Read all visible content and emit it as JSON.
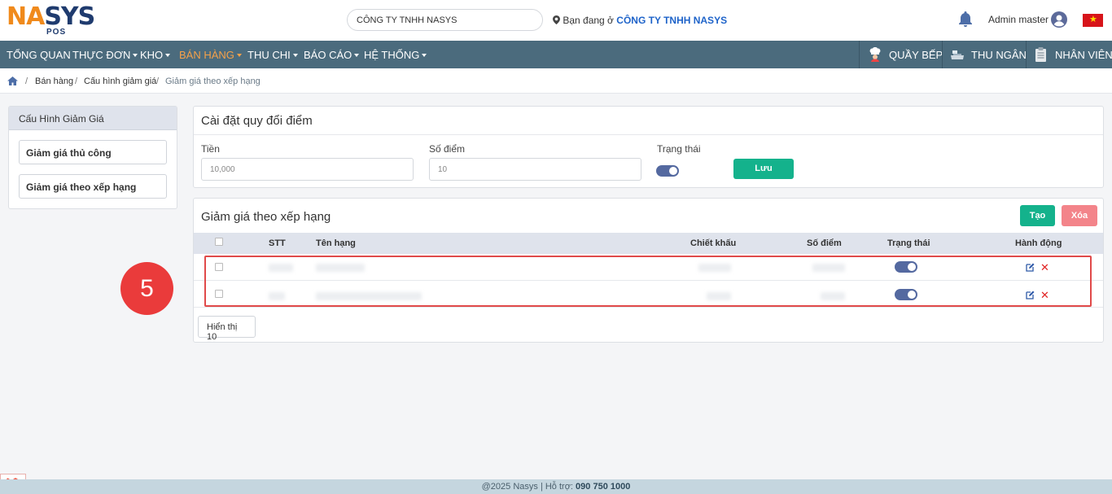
{
  "header": {
    "logo": {
      "part1": "NA",
      "part2": "SYS",
      "sub": "POS"
    },
    "company_select": "CÔNG TY TNHH NASYS",
    "location_prefix": "Bạn đang ở",
    "location_company": "CÔNG TY TNHH NASYS",
    "user_name": "Admin master",
    "colors": {
      "brand_orange": "#f08a1c",
      "brand_navy": "#1f3b6e",
      "link_blue": "#1e63c9"
    }
  },
  "nav": {
    "items": [
      {
        "label": "TỔNG QUAN"
      },
      {
        "label": "THỰC ĐƠN"
      },
      {
        "label": "KHO"
      },
      {
        "label": "BÁN HÀNG"
      },
      {
        "label": "THU CHI"
      },
      {
        "label": "BÁO CÁO"
      },
      {
        "label": "HỆ THỐNG"
      }
    ],
    "right": [
      {
        "label": "QUẦY BẾP",
        "icon": "chef-icon"
      },
      {
        "label": "THU NGÂN",
        "icon": "cashier-icon"
      },
      {
        "label": "NHÂN VIÊN",
        "icon": "clipboard-icon"
      }
    ],
    "colors": {
      "bg": "#4b6b7d",
      "active": "#f5a14a"
    }
  },
  "breadcrumb": [
    "Bán hàng",
    "Cấu hình giảm giá",
    "Giảm giá theo xếp hạng"
  ],
  "sidebar": {
    "title": "Cấu Hình Giảm Giá",
    "items": [
      {
        "label": "Giảm giá thủ công"
      },
      {
        "label": "Giảm giá theo xếp hạng"
      }
    ]
  },
  "points_panel": {
    "title": "Cài đặt quy đổi điểm",
    "money_label": "Tiền",
    "money_value": "10,000",
    "points_label": "Số điểm",
    "points_value": "10",
    "status_label": "Trạng thái",
    "save_label": "Lưu"
  },
  "rank_panel": {
    "title": "Giảm giá theo xếp hạng",
    "create_label": "Tạo",
    "delete_label": "Xóa",
    "columns": {
      "stt": "STT",
      "name": "Tên hạng",
      "discount": "Chiết khấu",
      "points": "Số điểm",
      "status": "Trạng thái",
      "actions": "Hành động"
    },
    "show_label": "Hiển thị 10"
  },
  "step_badge": "5",
  "footer": {
    "text": "@2025 Nasys | Hỗ trợ:",
    "phone": "090 750 1000"
  }
}
